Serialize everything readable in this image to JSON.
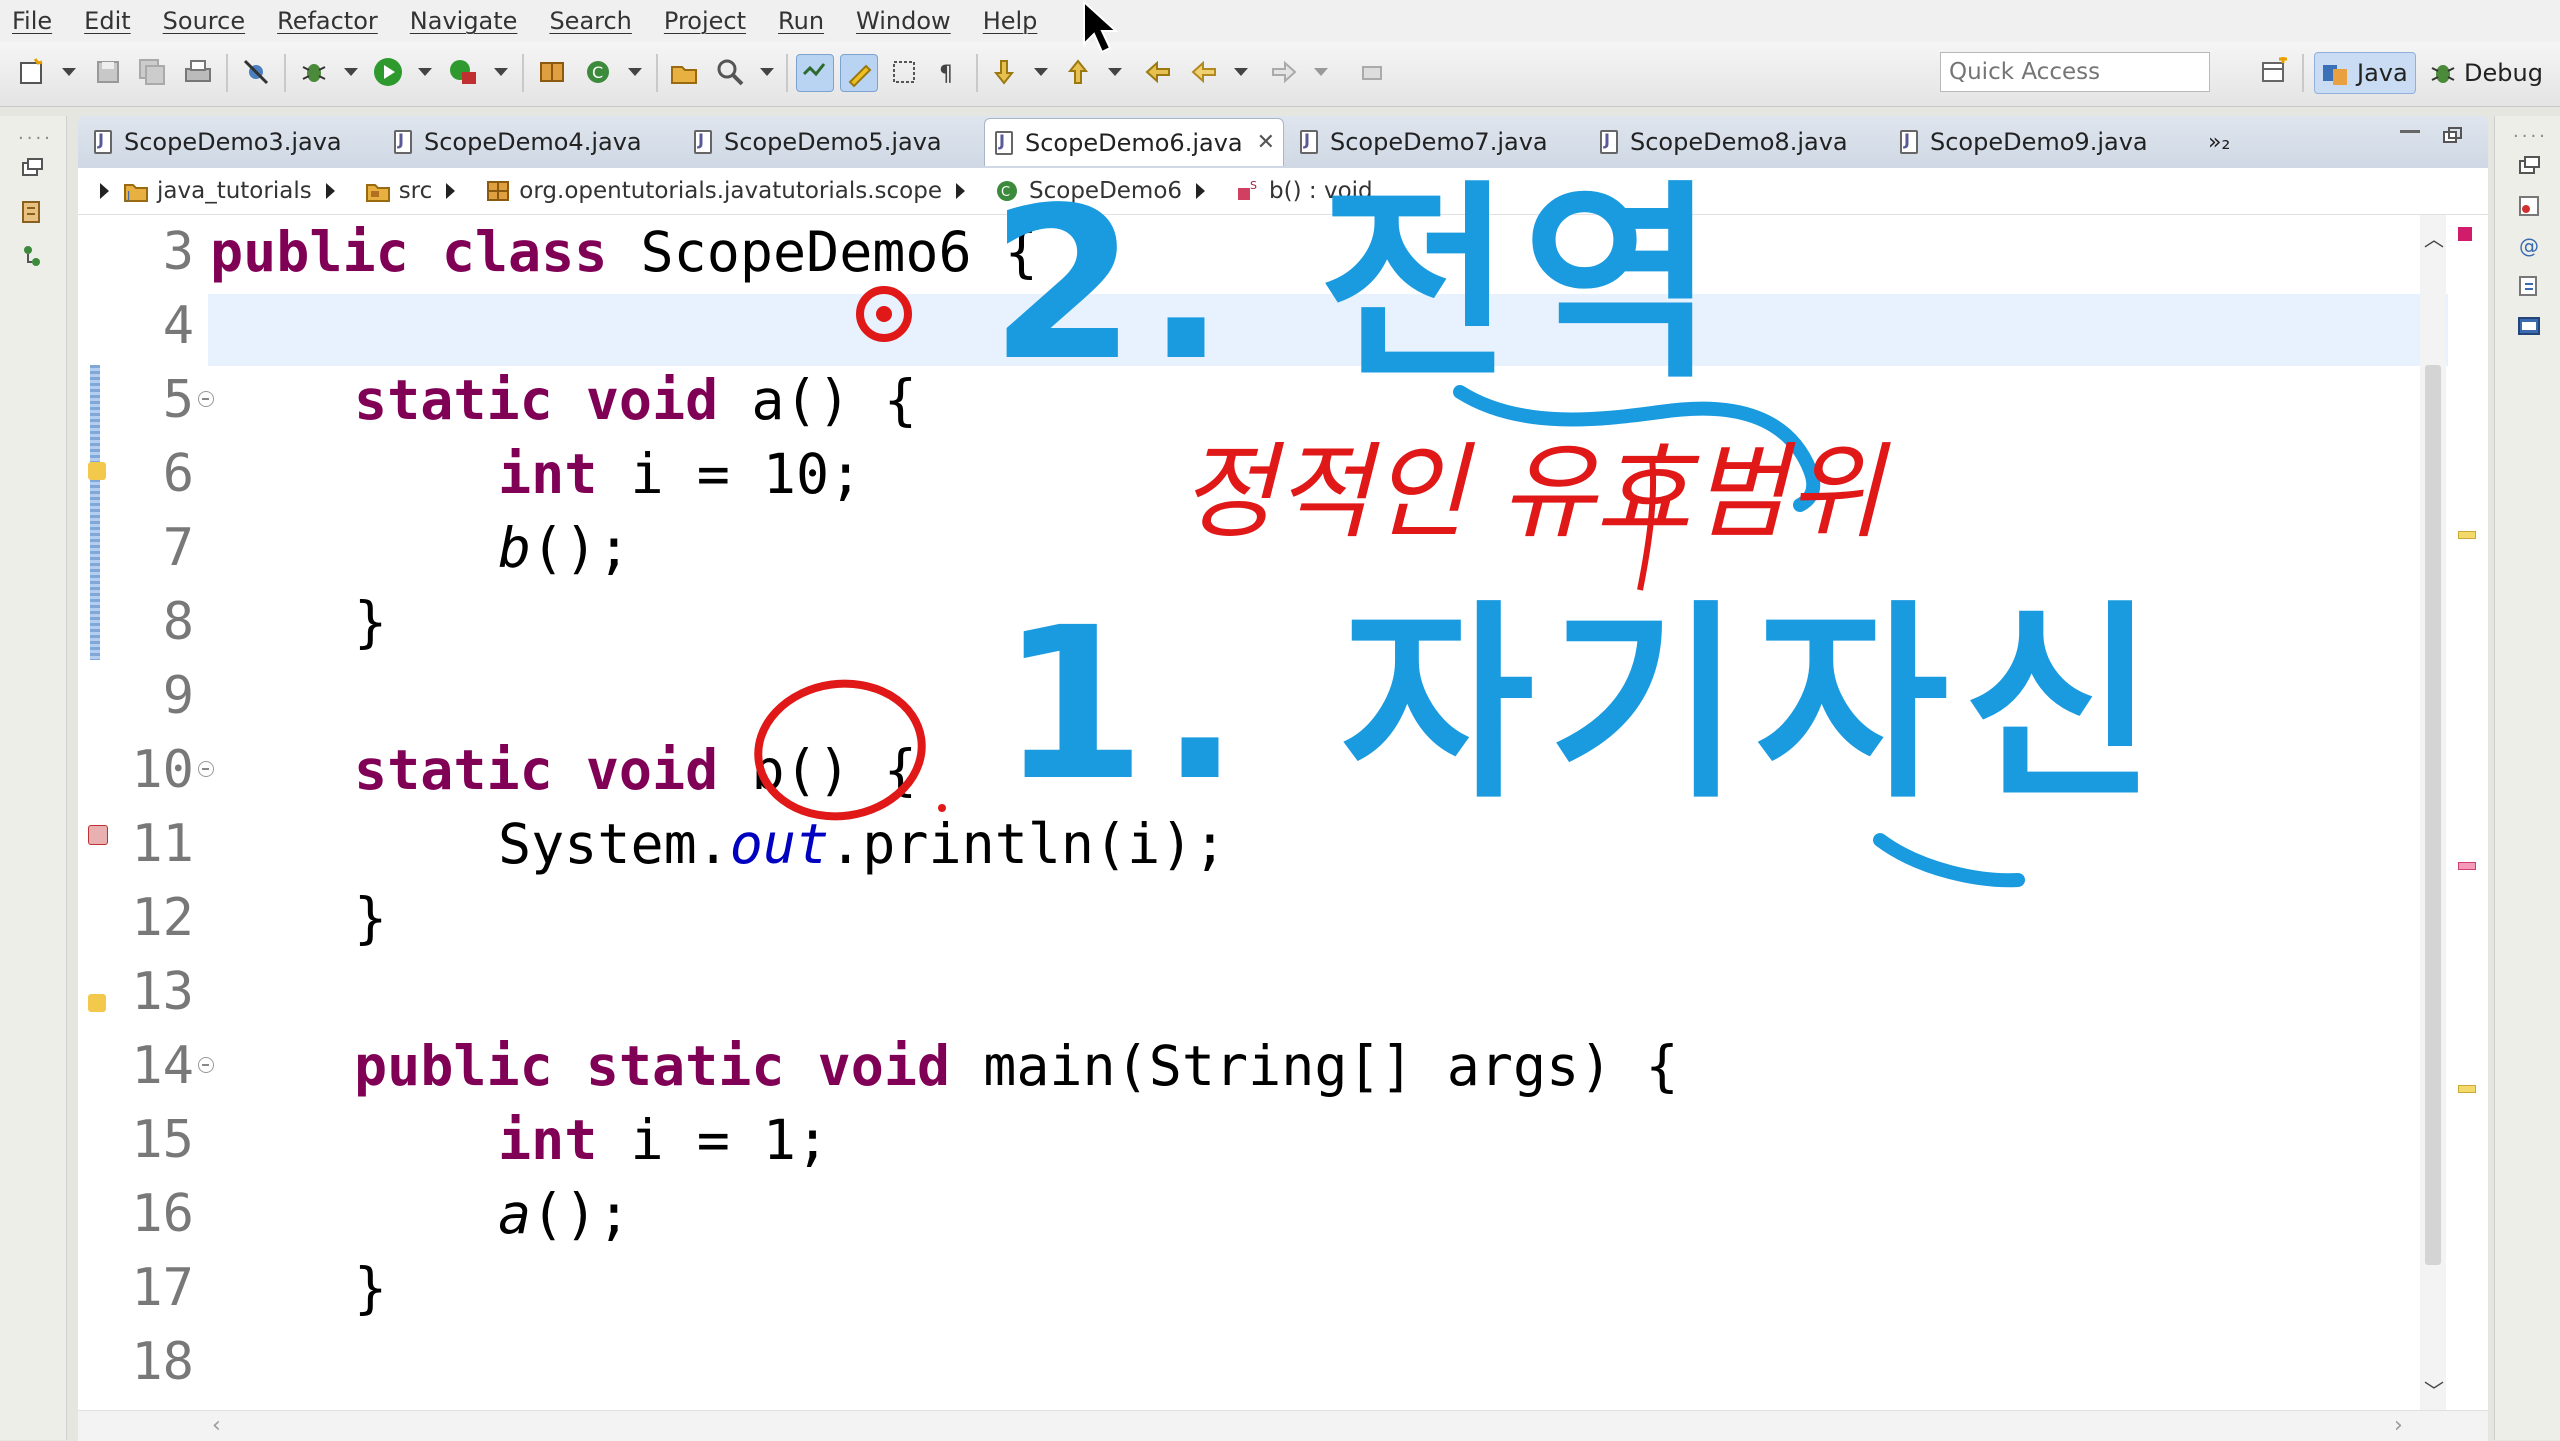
{
  "menu": [
    "File",
    "Edit",
    "Source",
    "Refactor",
    "Navigate",
    "Search",
    "Project",
    "Run",
    "Window",
    "Help"
  ],
  "toolbar": {
    "quick_access_placeholder": "Quick Access",
    "perspective_java": "Java",
    "perspective_debug": "Debug"
  },
  "tabs": [
    {
      "label": "ScopeDemo3.java",
      "active": false
    },
    {
      "label": "ScopeDemo4.java",
      "active": false
    },
    {
      "label": "ScopeDemo5.java",
      "active": false
    },
    {
      "label": "ScopeDemo6.java",
      "active": true
    },
    {
      "label": "ScopeDemo7.java",
      "active": false
    },
    {
      "label": "ScopeDemo8.java",
      "active": false
    },
    {
      "label": "ScopeDemo9.java",
      "active": false
    }
  ],
  "tabs_overflow": "»₂",
  "breadcrumb": [
    "java_tutorials",
    "src",
    "org.opentutorials.javatutorials.scope",
    "ScopeDemo6",
    "b() : void"
  ],
  "editor": {
    "line_numbers": [
      "3",
      "4",
      "5",
      "6",
      "7",
      "8",
      "9",
      "10",
      "11",
      "12",
      "13",
      "14",
      "15",
      "16",
      "17",
      "18"
    ],
    "code": {
      "l3_kw1": "public",
      "l3_kw2": "class",
      "l3_name": "ScopeDemo6",
      "l3_brace": "{",
      "l5_kw1": "static",
      "l5_kw2": "void",
      "l5_rest": "a() {",
      "l6_kw": "int",
      "l6_rest": "i = 10;",
      "l7_call": "b",
      "l7_rest": "();",
      "l8": "}",
      "l10_kw1": "static",
      "l10_kw2": "void",
      "l10_rest": "b() {",
      "l11_pre": "System.",
      "l11_field": "out",
      "l11_rest": ".println(i);",
      "l12": "}",
      "l14_kw1": "public",
      "l14_kw2": "static",
      "l14_kw3": "void",
      "l14_rest": "main(String[] args) {",
      "l15_kw": "int",
      "l15_rest": "i = 1;",
      "l16_call": "a",
      "l16_rest": "();",
      "l17": "}"
    }
  },
  "annotations": {
    "blue_top": "2. 전역",
    "red_note": "정적인 유효범위",
    "blue_bottom": "1. 자기자신"
  },
  "colors": {
    "keyword": "#7f0055",
    "field": "#0000c0",
    "annotation_blue": "#1a9be0",
    "annotation_red": "#e01818"
  }
}
